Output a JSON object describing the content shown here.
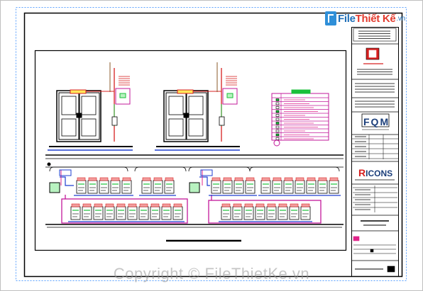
{
  "site_logo": {
    "part1": "File",
    "part2": "Thiết Kế",
    "part3": ".vn"
  },
  "watermark": "Copyright © FileThietKe.vn",
  "title_block": {
    "logo_fqm": "FQM",
    "logo_ricons_r": "R",
    "logo_ricons_rest": "ICONS"
  },
  "colors": {
    "paper": "#ffffff",
    "frame": "#000000",
    "red": "#d72020",
    "pink": "#e0248a",
    "magenta": "#c2189a",
    "blue": "#1f3fd0",
    "green": "#19c03a",
    "brown": "#8a5a2a",
    "grey": "#9a9a9a"
  }
}
